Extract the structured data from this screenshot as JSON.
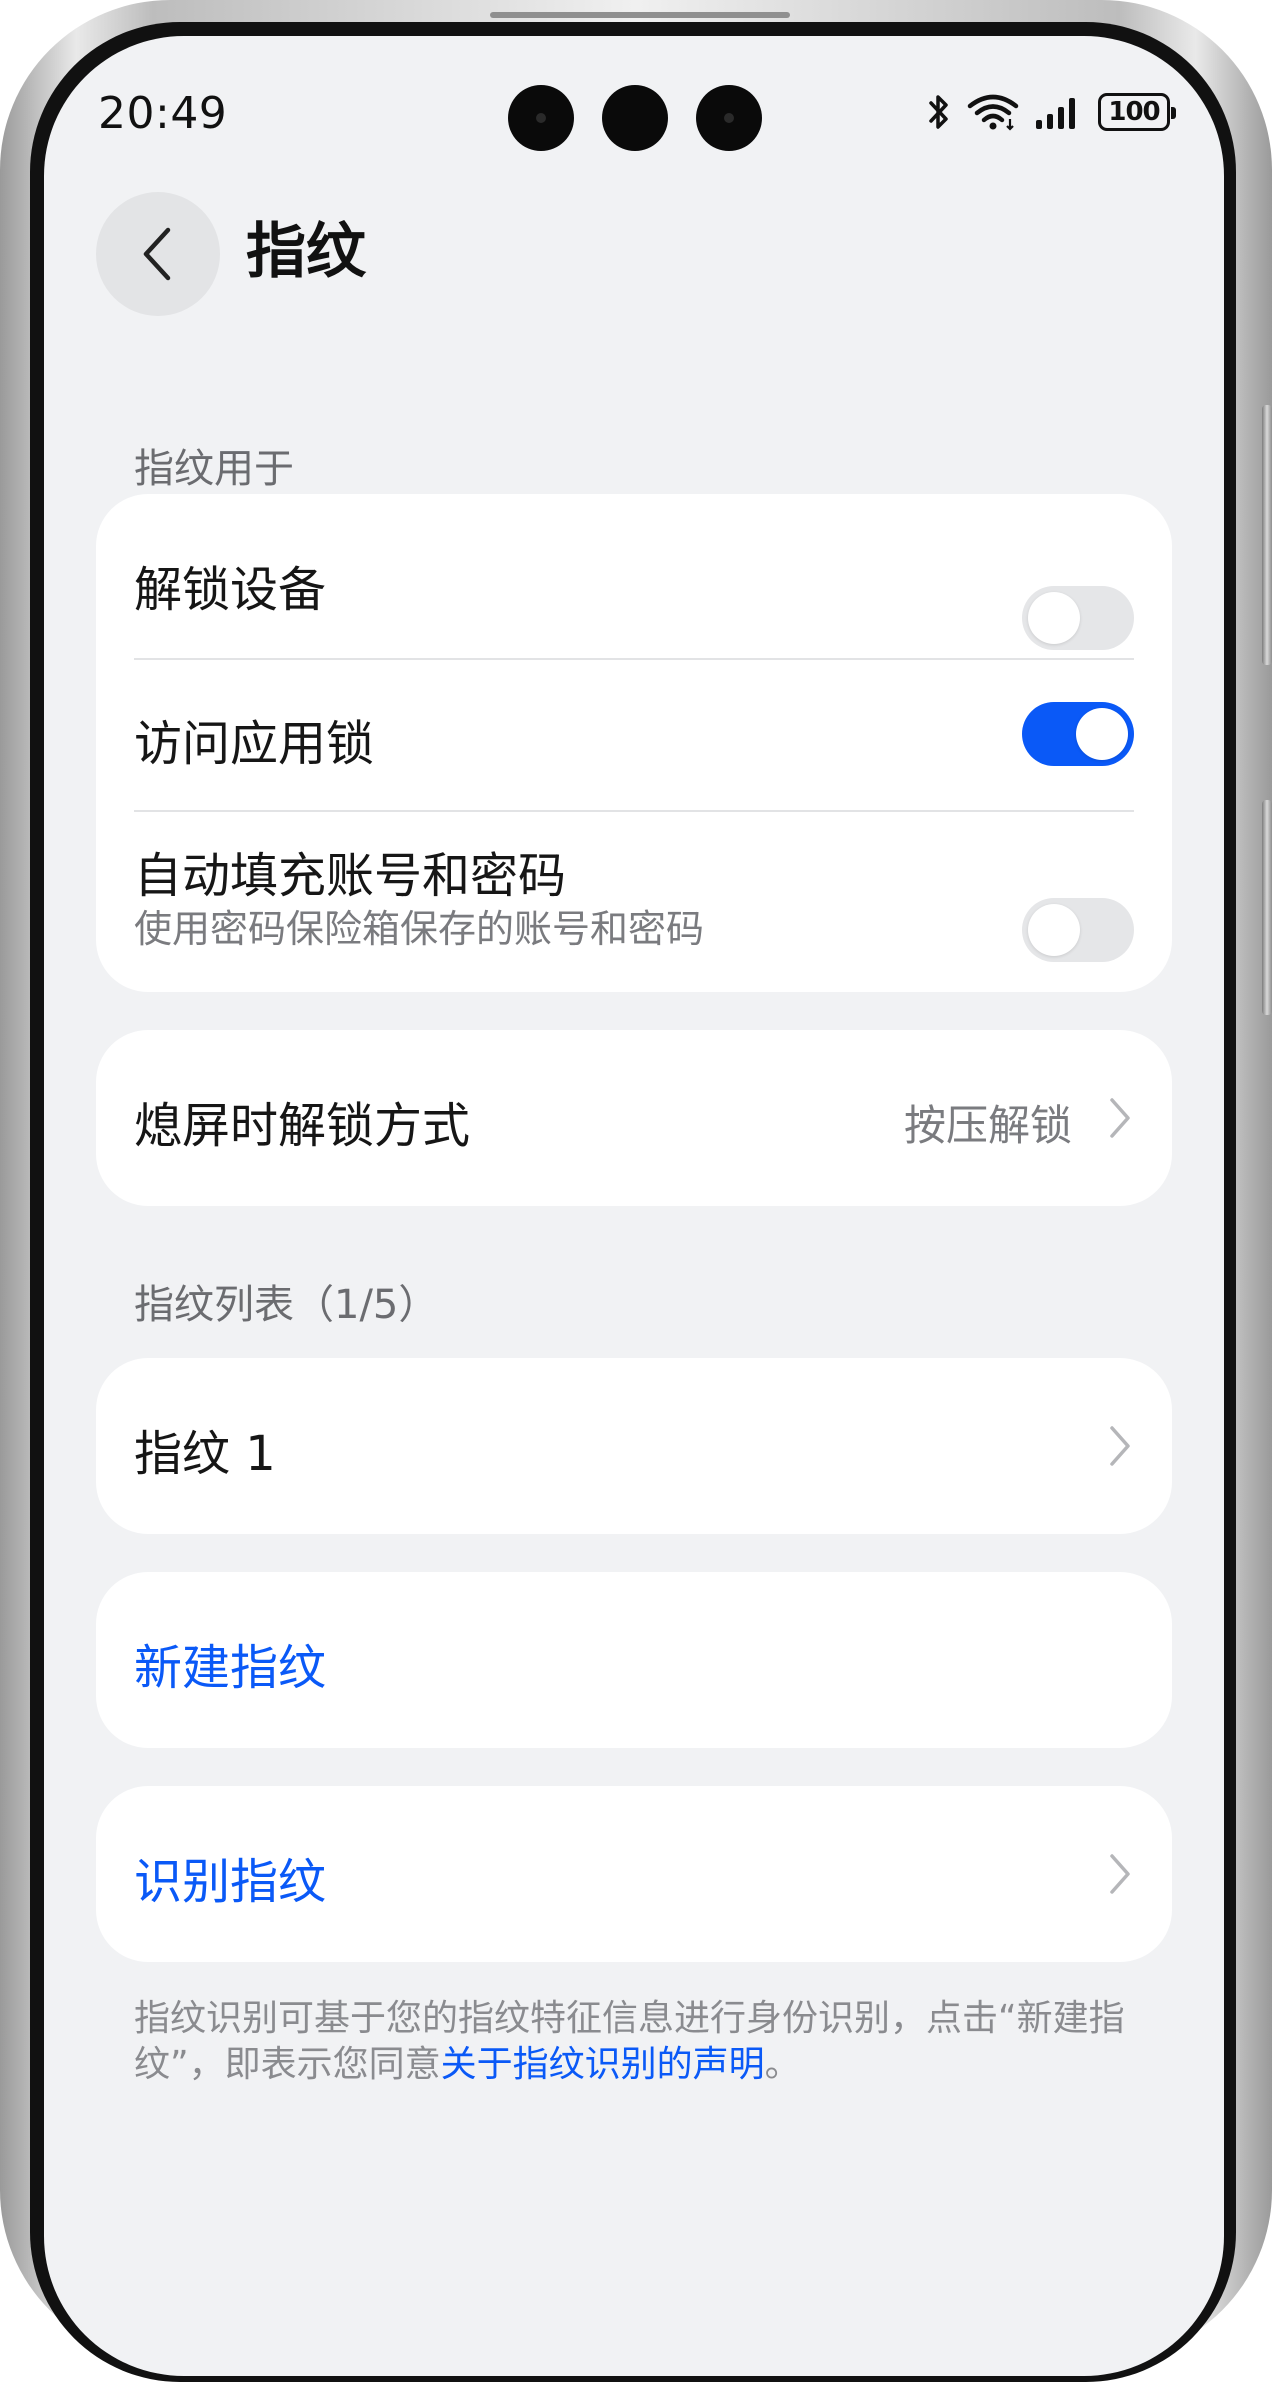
{
  "status_bar": {
    "time": "20:49",
    "battery": "100",
    "icons": [
      "bluetooth-icon",
      "wifi-icon",
      "signal-icon",
      "battery-icon"
    ]
  },
  "header": {
    "title": "指纹",
    "back_icon": "chevron-left-icon"
  },
  "section_usage": {
    "label": "指纹用于",
    "items": [
      {
        "label": "解锁设备",
        "enabled": false
      },
      {
        "label": "访问应用锁",
        "enabled": true
      },
      {
        "label": "自动填充账号和密码",
        "sublabel": "使用密码保险箱保存的账号和密码",
        "enabled": false
      }
    ]
  },
  "screen_off_unlock": {
    "label": "熄屏时解锁方式",
    "value": "按压解锁"
  },
  "section_list": {
    "label": "指纹列表（1/5）",
    "items": [
      {
        "label": "指纹 1"
      }
    ]
  },
  "actions": {
    "new": "新建指纹",
    "identify": "识别指纹"
  },
  "footnote": {
    "text": "指纹识别可基于您的指纹特征信息进行身份识别，点击“新建指纹”，即表示您同意",
    "link": "关于指纹识别的声明",
    "end": "。"
  },
  "colors": {
    "accent": "#0a59f7",
    "background": "#f1f2f4",
    "card": "#ffffff"
  }
}
